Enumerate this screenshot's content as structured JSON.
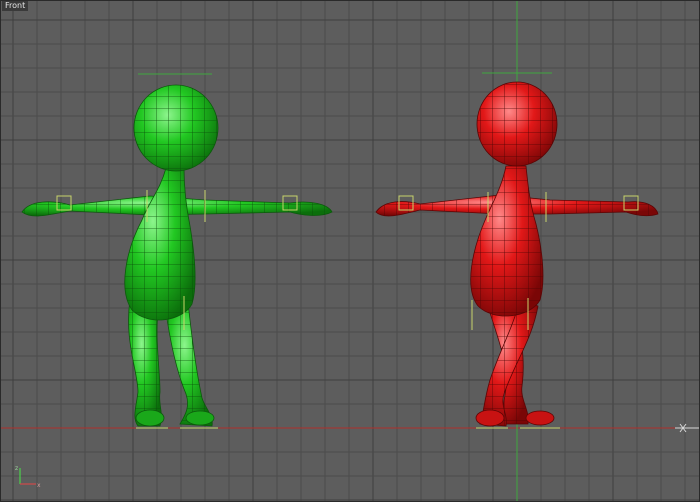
{
  "viewport": {
    "label": "Front",
    "background": "#5d5d5d",
    "grid_color": "#4b4b4b",
    "grid_major_color": "#3f3f3f",
    "ground_line_color": "#b0302a",
    "vertical_axis_color": "#3fa83f"
  },
  "models": [
    {
      "name": "green-character",
      "fill": "#1fc41f",
      "wire": "#0c5a0c",
      "highlight": "#7cf07c"
    },
    {
      "name": "red-character",
      "fill": "#e01414",
      "wire": "#5c0505",
      "highlight": "#ff7a7a"
    }
  ],
  "axis_tripod": {
    "x_label": "x",
    "y_label": "z",
    "x_color": "#d04a4a",
    "y_color": "#4ad04a"
  }
}
